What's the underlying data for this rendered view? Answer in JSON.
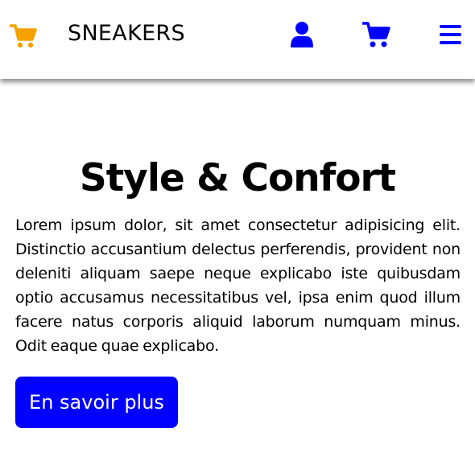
{
  "header": {
    "brand": "SNEAKERS",
    "logo_icon": "shopping-cart-icon",
    "nav_icons": [
      "user-icon",
      "shopping-cart-icon",
      "menu-icon"
    ],
    "colors": {
      "logo": "#f5a100",
      "nav": "#0000ff"
    }
  },
  "hero": {
    "title": "Style & Confort",
    "description": "Lorem ipsum dolor, sit amet consectetur adipisicing elit. Distinctio accusantium delectus perferendis, provident non deleniti aliquam saepe neque explicabo iste quibusdam optio accusamus necessitatibus vel, ipsa enim quod illum facere natus corporis aliquid laborum numquam minus. Odit eaque quae explicabo.",
    "cta_label": "En savoir plus",
    "cta_color": "#0000ff"
  }
}
